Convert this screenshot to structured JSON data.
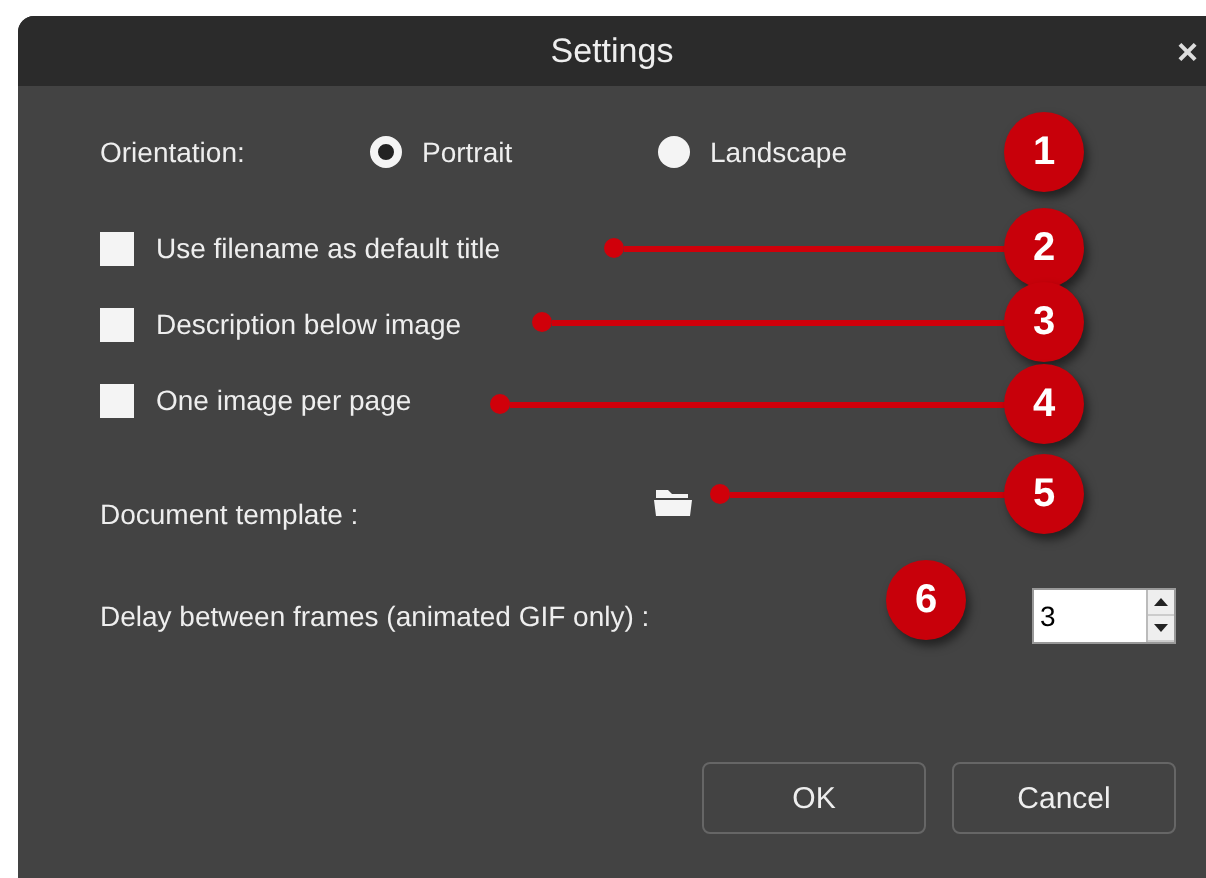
{
  "window": {
    "title": "Settings",
    "close": "×"
  },
  "orientation": {
    "label": "Orientation:",
    "options": [
      {
        "label": "Portrait",
        "selected": true
      },
      {
        "label": "Landscape",
        "selected": false
      }
    ]
  },
  "checkboxes": [
    {
      "label": "Use filename as default title",
      "checked": false
    },
    {
      "label": "Description below image",
      "checked": false
    },
    {
      "label": "One image per page",
      "checked": false
    }
  ],
  "document_template": {
    "label": "Document template :"
  },
  "delay": {
    "label": "Delay between frames (animated GIF only) :",
    "value": "3"
  },
  "buttons": [
    "OK",
    "Cancel"
  ],
  "annotations": [
    "1",
    "2",
    "3",
    "4",
    "5",
    "6"
  ]
}
